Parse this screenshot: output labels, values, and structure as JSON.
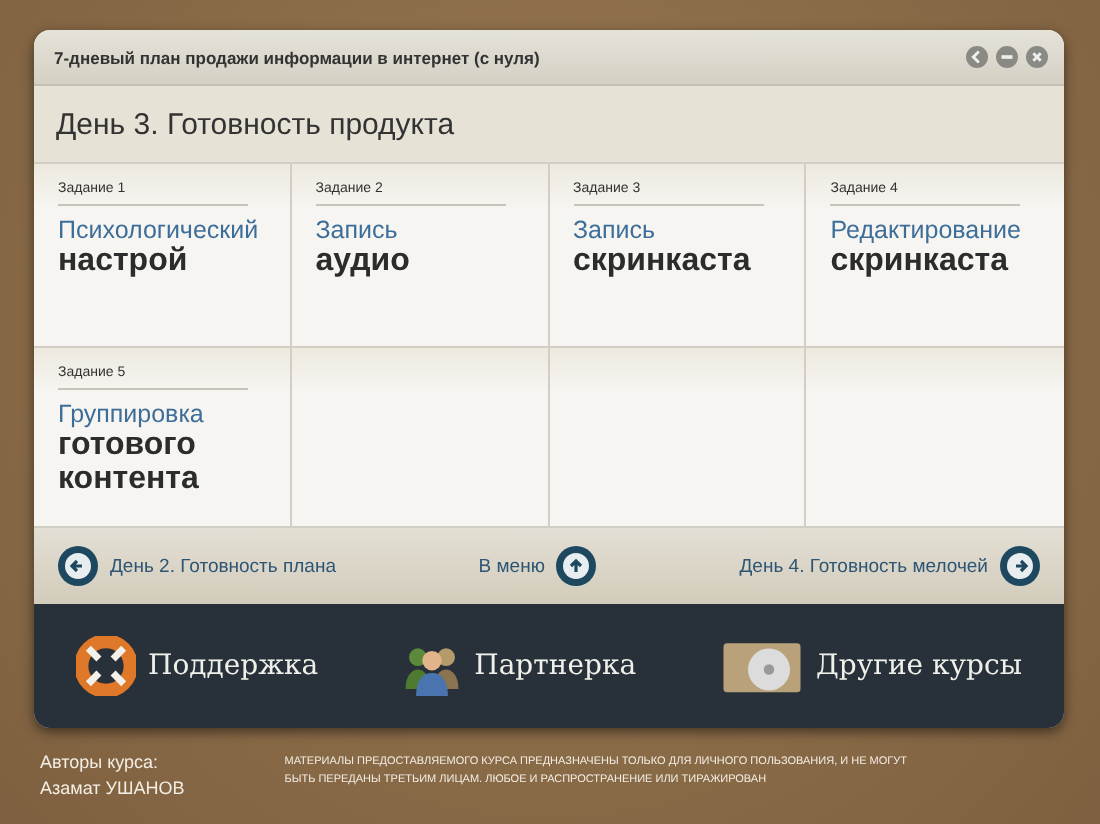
{
  "window": {
    "title": "7-дневый план продажи информации в интернет (с нуля)",
    "controls": [
      {
        "kind": "back"
      },
      {
        "kind": "minimize"
      },
      {
        "kind": "close"
      }
    ]
  },
  "heading": "День 3. Готовность продукта",
  "tasks": [
    {
      "label": "Задание 1",
      "title": "Психологический",
      "subtitle": "настрой"
    },
    {
      "label": "Задание 2",
      "title": "Запись",
      "subtitle": "аудио"
    },
    {
      "label": "Задание 3",
      "title": "Запись",
      "subtitle": "скринкаста"
    },
    {
      "label": "Задание 4",
      "title": "Редактирование",
      "subtitle": "скринкаста"
    },
    {
      "label": "Задание 5",
      "title": "Группировка",
      "subtitle": "готового контента"
    }
  ],
  "navigation": [
    {
      "kind": "prev",
      "label": "День 2. Готовность плана"
    },
    {
      "kind": "menu",
      "label": "В меню"
    },
    {
      "kind": "next",
      "label": "День 4. Готовность мелочей"
    }
  ],
  "bottom_bar": [
    {
      "kind": "support",
      "label": "Поддержка"
    },
    {
      "kind": "partner",
      "label": "Партнерка"
    },
    {
      "kind": "courses",
      "label": "Другие курсы"
    }
  ],
  "footer": {
    "authors_label": "Авторы курса:",
    "author": "Азамат УШАНОВ",
    "notice_lines": [
      "МАТЕРИАЛЫ ПРЕДОСТАВЛЯЕМОГО КУРСА ПРЕДНАЗНАЧЕНЫ ТОЛЬКО ДЛЯ ЛИЧНОГО ПОЛЬЗОВАНИЯ, И НЕ МОГУТ",
      "БЫТЬ ПЕРЕДАНЫ ТРЕТЬИМ ЛИЦАМ. ЛЮБОЕ И РАСПРОСТРАНЕНИЕ ИЛИ ТИРАЖИРОВАН"
    ]
  }
}
